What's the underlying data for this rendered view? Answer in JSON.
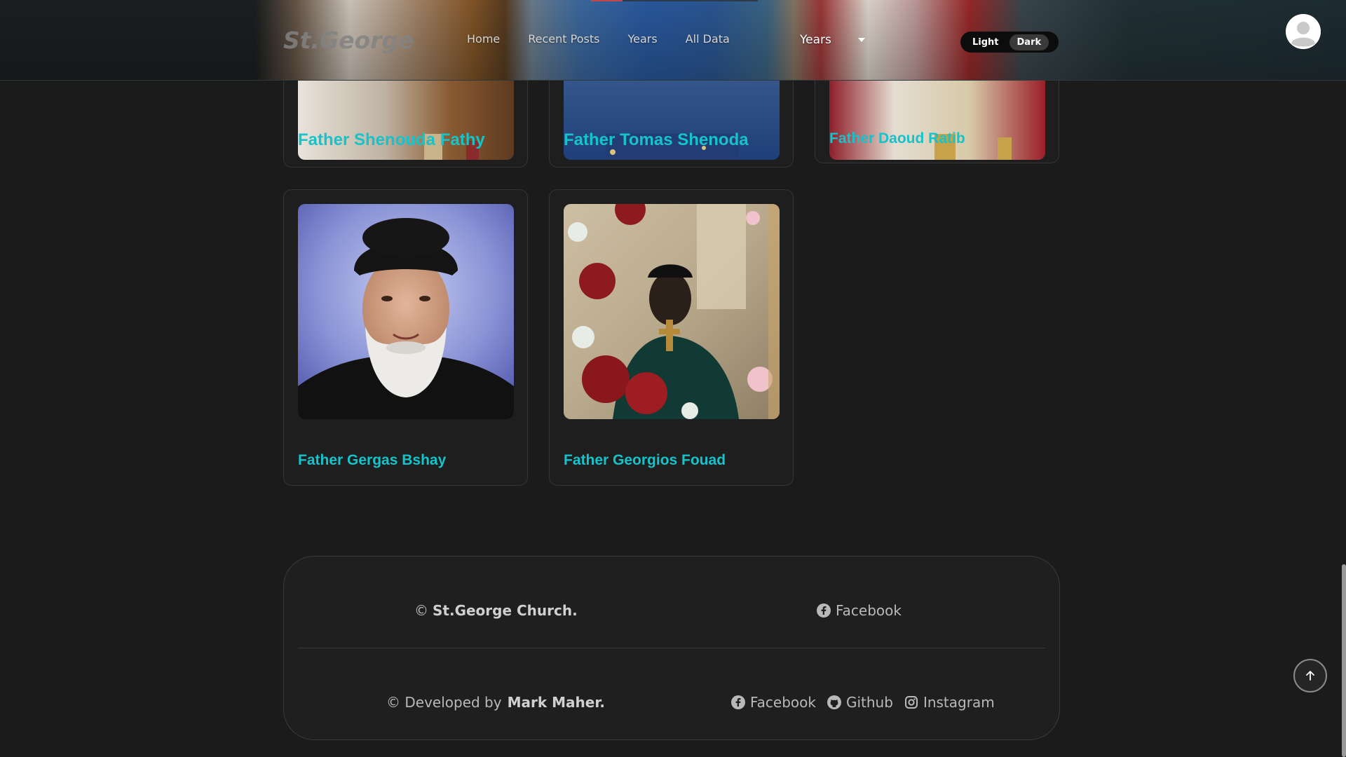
{
  "navbar": {
    "logo": "St.George",
    "links": [
      "Home",
      "Recent Posts",
      "Years",
      "All Data"
    ],
    "years_dropdown": "Years",
    "theme": {
      "light": "Light",
      "dark": "Dark",
      "selected": "Dark"
    },
    "avatar_icon": "user-avatar-icon"
  },
  "cards": [
    {
      "name": "Father Shenouda Fathy"
    },
    {
      "name": "Father Tomas Shenoda"
    },
    {
      "name": "Father Daoud Ratib"
    },
    {
      "name": "Father Gergas Bshay"
    },
    {
      "name": "Father Georgios Fouad"
    }
  ],
  "footer": {
    "copyright_symbol": "©",
    "church": "St.George Church.",
    "facebook": "Facebook",
    "developed_prefix": "© Developed by",
    "developer": "Mark Maher.",
    "social": {
      "facebook": "Facebook",
      "github": "Github",
      "instagram": "Instagram"
    }
  },
  "colors": {
    "accent": "#15c3cb",
    "background": "#1b1b1b",
    "card": "#1e1e1e"
  },
  "scroll_top_icon": "arrow-up-icon"
}
